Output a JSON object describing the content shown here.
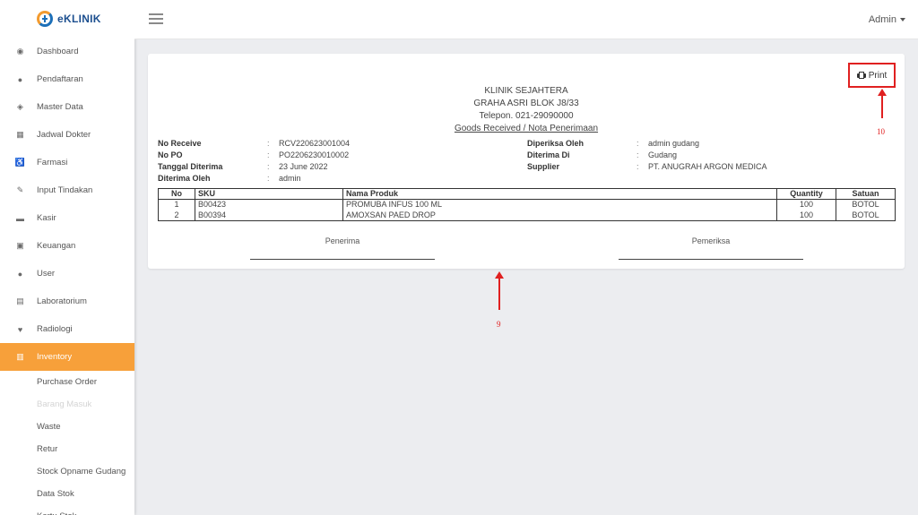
{
  "brand": {
    "logo_text": "eKLINIK"
  },
  "topbar": {
    "user_label": "Admin"
  },
  "sidebar": {
    "items": [
      {
        "label": "Dashboard",
        "icon": "dashboard-icon",
        "glyph": "◉"
      },
      {
        "label": "Pendaftaran",
        "icon": "user-icon",
        "glyph": "●"
      },
      {
        "label": "Master Data",
        "icon": "database-icon",
        "glyph": "◈"
      },
      {
        "label": "Jadwal Dokter",
        "icon": "calendar-icon",
        "glyph": "▦"
      },
      {
        "label": "Farmasi",
        "icon": "wheelchair-icon",
        "glyph": "♿"
      },
      {
        "label": "Input Tindakan",
        "icon": "stethoscope-icon",
        "glyph": "✎"
      },
      {
        "label": "Kasir",
        "icon": "cart-icon",
        "glyph": "▬"
      },
      {
        "label": "Keuangan",
        "icon": "money-icon",
        "glyph": "▣"
      },
      {
        "label": "User",
        "icon": "users-icon",
        "glyph": "●"
      },
      {
        "label": "Laboratorium",
        "icon": "briefcase-icon",
        "glyph": "▤"
      },
      {
        "label": "Radiologi",
        "icon": "heartbeat-icon",
        "glyph": "♥"
      },
      {
        "label": "Inventory",
        "icon": "inventory-icon",
        "glyph": "▥"
      }
    ],
    "submenu": [
      {
        "label": "Purchase Order",
        "disabled": false
      },
      {
        "label": "Barang Masuk",
        "disabled": true
      },
      {
        "label": "Waste",
        "disabled": false
      },
      {
        "label": "Retur",
        "disabled": false
      },
      {
        "label": "Stock Opname Gudang",
        "disabled": false
      },
      {
        "label": "Data Stok",
        "disabled": false
      },
      {
        "label": "Kartu Stok",
        "disabled": false
      }
    ]
  },
  "print_button": {
    "label": "Print"
  },
  "clinic": {
    "name": "KLINIK SEJAHTERA",
    "address": "GRAHA ASRI BLOK J8/33",
    "phone": "Telepon. 021-29090000",
    "doc_title": "Goods Received / Nota Penerimaan"
  },
  "info_left": [
    {
      "label": "No Receive",
      "sep": ":",
      "value": "RCV220623001004"
    },
    {
      "label": "No PO",
      "sep": ":",
      "value": "PO2206230010002"
    },
    {
      "label": "Tanggal Diterima",
      "sep": ":",
      "value": "23 June 2022"
    },
    {
      "label": "Diterima Oleh",
      "sep": ":",
      "value": "admin"
    }
  ],
  "info_right": [
    {
      "label": "Diperiksa Oleh",
      "sep": ":",
      "value": "admin gudang"
    },
    {
      "label": "Diterima Di",
      "sep": ":",
      "value": "Gudang"
    },
    {
      "label": "Supplier",
      "sep": ":",
      "value": "PT. ANUGRAH ARGON MEDICA"
    }
  ],
  "table": {
    "headers": [
      "No",
      "SKU",
      "Nama Produk",
      "Quantity",
      "Satuan"
    ],
    "rows": [
      [
        "1",
        "B00423",
        "PROMUBA INFUS 100 ML",
        "100",
        "BOTOL"
      ],
      [
        "2",
        "B00394",
        "AMOXSAN PAED DROP",
        "100",
        "BOTOL"
      ]
    ]
  },
  "signatures": {
    "left": "Penerima",
    "right": "Pemeriksa"
  },
  "annotations": {
    "print": "10",
    "card": "9",
    "color": "#e02020"
  },
  "colors": {
    "active_menu": "#f7a03a",
    "brand_blue": "#1c6fb8",
    "brand_orange": "#f39b2f"
  }
}
